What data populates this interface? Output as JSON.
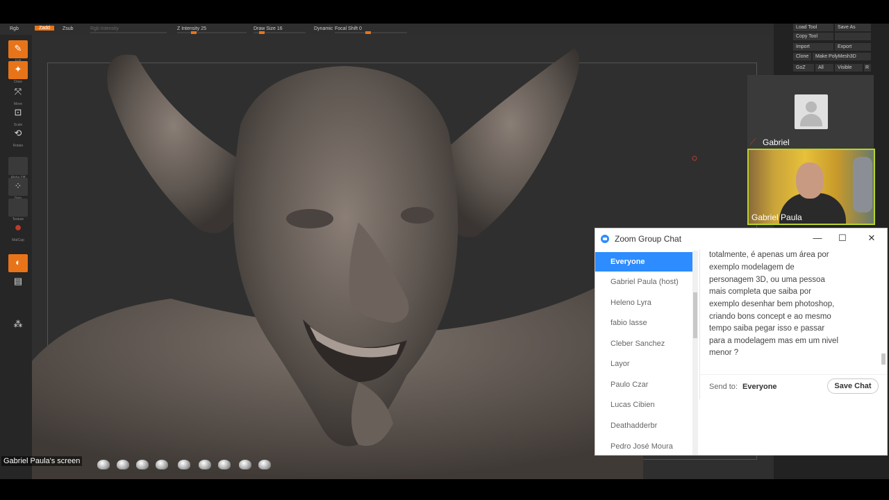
{
  "zbrush": {
    "topbar": {
      "rgb": "Rgb",
      "zadd": "Zadd",
      "zsub": "Zsub",
      "rgb_intensity": "Rgb Intensity",
      "z_intensity": "Z Intensity 25",
      "draw_size": "Draw Size 16",
      "dynamic": "Dynamic",
      "focal_shift": "Focal Shift 0"
    },
    "left_tools": [
      {
        "cap": "Edit",
        "icon": "edit-icon",
        "glyph": "✎"
      },
      {
        "cap": "Draw",
        "icon": "draw-icon",
        "glyph": "✦"
      },
      {
        "cap": "Move",
        "icon": "move-icon",
        "glyph": "⤧"
      },
      {
        "cap": "Scale",
        "icon": "scale-icon",
        "glyph": "⊡"
      },
      {
        "cap": "Rotate",
        "icon": "rotate-icon",
        "glyph": "⟲"
      },
      {
        "cap": "Alpha Off",
        "icon": "alpha-icon",
        "glyph": ""
      },
      {
        "cap": "Dots",
        "icon": "stroke-icon",
        "glyph": "⁘"
      },
      {
        "cap": "Texture",
        "icon": "texture-icon",
        "glyph": ""
      },
      {
        "cap": "MatCap",
        "icon": "material-icon",
        "glyph": "●"
      },
      {
        "cap": "",
        "icon": "color-icon",
        "glyph": "◐"
      },
      {
        "cap": "",
        "icon": "gradient-icon",
        "glyph": "▤"
      },
      {
        "cap": "",
        "icon": "sym-icon",
        "glyph": "⁂"
      }
    ],
    "right_panel": {
      "load_tool": "Load Tool",
      "save_as": "Save As",
      "copy_tool": "Copy Tool",
      "import": "Import",
      "export": "Export",
      "clone": "Clone",
      "make_polymesh": "Make PolyMesh3D",
      "goz": "GoZ",
      "all": "All",
      "visible": "Visible",
      "r": "R"
    },
    "screen_label": "Gabriel Paula's screen"
  },
  "participants": {
    "gabriel": "Gabriel",
    "paula": "Gabriel Paula"
  },
  "chat": {
    "title": "Zoom Group Chat",
    "list": [
      "Everyone",
      "Gabriel Paula (host)",
      "Heleno Lyra",
      "fabio lasse",
      "Cleber Sanchez",
      "Layor",
      "Paulo Czar",
      "Lucas Cibien",
      "Deathadderbr",
      "Pedro José Moura"
    ],
    "message_lines": [
      "totalmente, é apenas um área por",
      "exemplo modelagem de",
      "personagem 3D, ou uma pessoa",
      "mais completa que saiba por",
      "exemplo desenhar bem photoshop,",
      "criando bons concept e ao mesmo",
      "tempo saiba pegar isso e passar",
      "para a modelagem mas em um nivel",
      "menor ?"
    ],
    "send_to_label": "Send to:",
    "send_to_value": "Everyone",
    "save_chat": "Save Chat",
    "minimize": "—",
    "maximize": "☐",
    "close": "✕"
  },
  "colors": {
    "zbrush_orange": "#e8741a",
    "zoom_blue": "#2d8cff",
    "active_speaker": "#b6d42c"
  }
}
